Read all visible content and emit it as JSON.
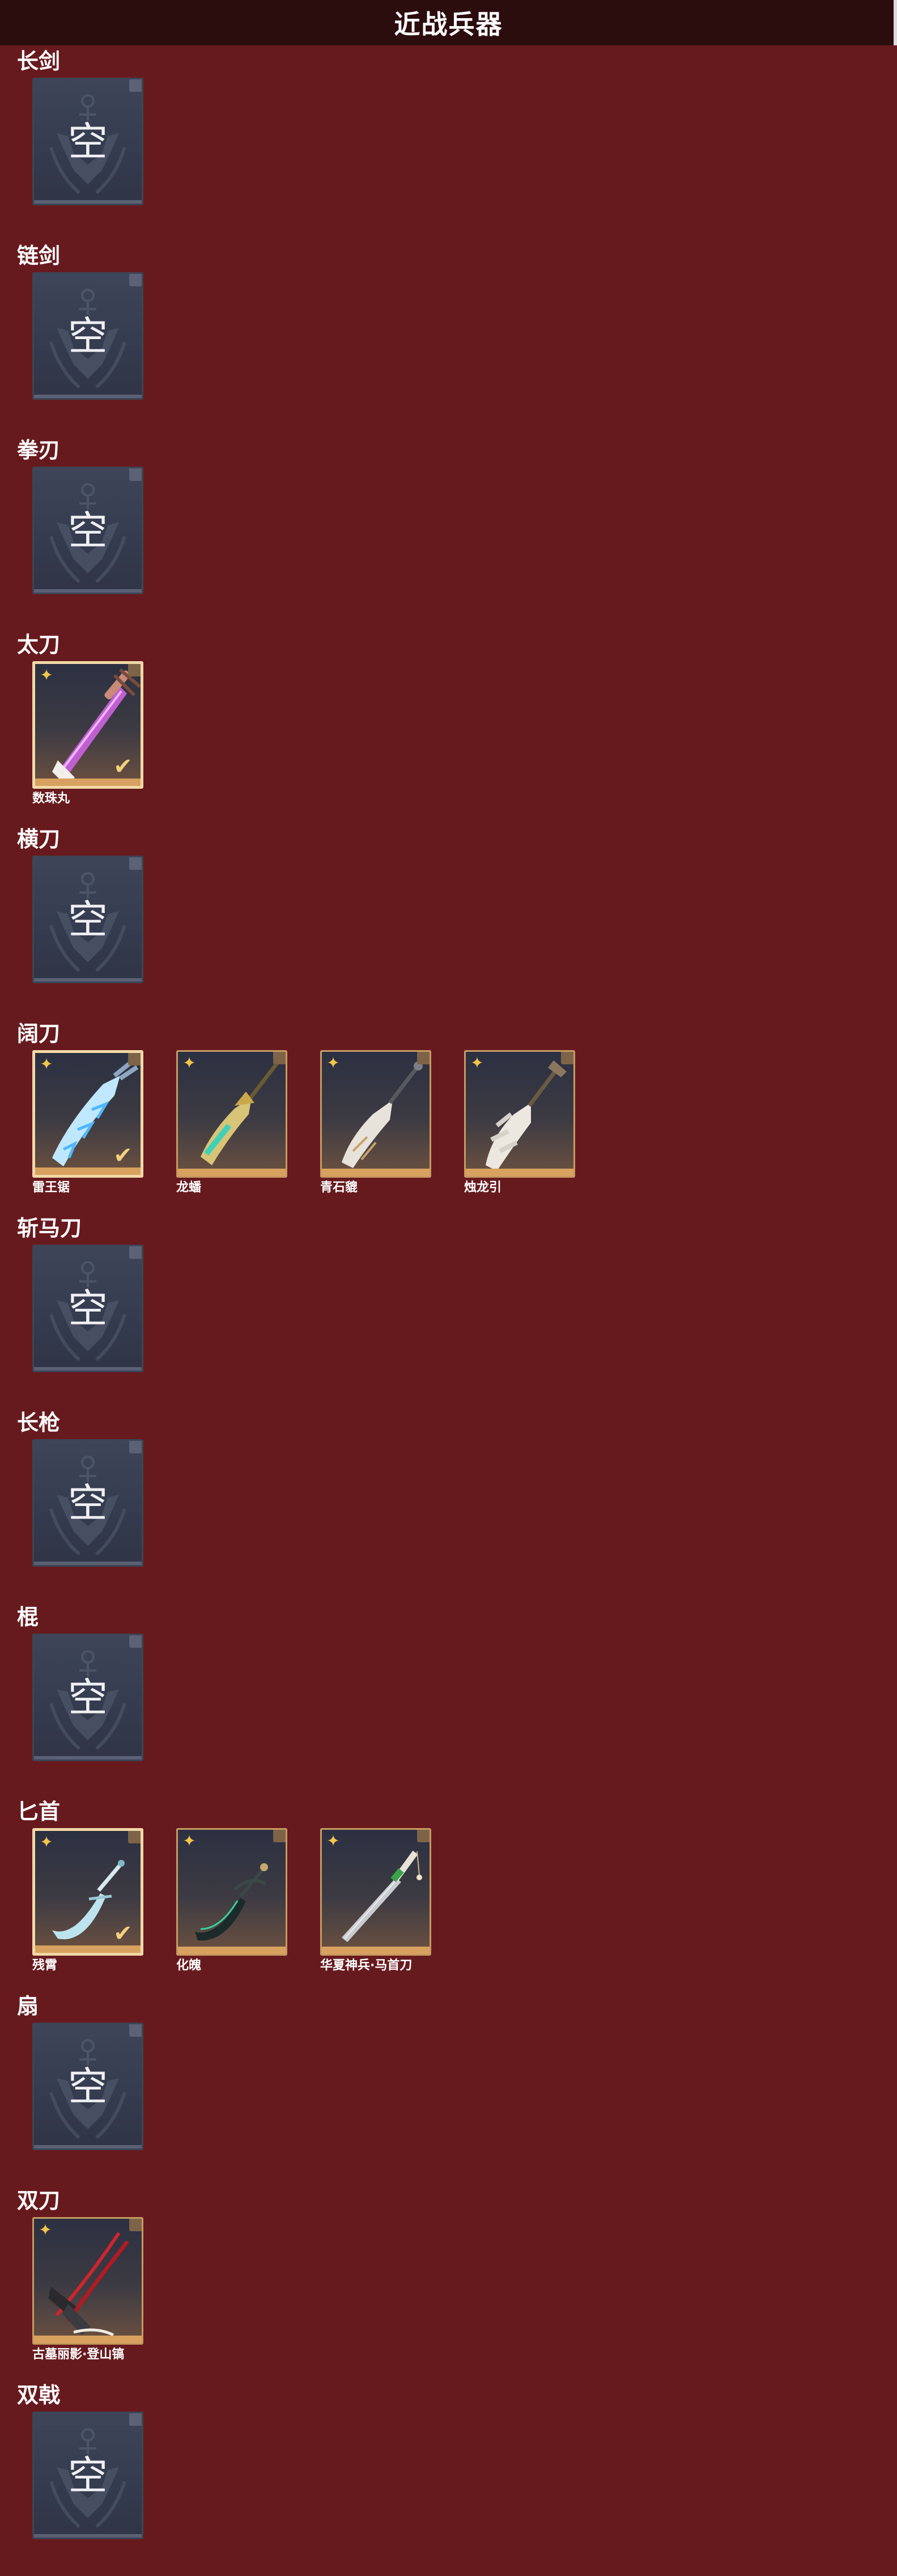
{
  "header": {
    "title": "近战兵器"
  },
  "empty_label": "空",
  "colors": {
    "background": "#671a1e",
    "header": "#2c0d0e",
    "card_empty": "#3e4559",
    "card_owned_border": "#c69a5f",
    "equipped_border": "#f1d8a6",
    "rarity_gold": "#f0c54b"
  },
  "categories": [
    {
      "label": "长剑",
      "items": []
    },
    {
      "label": "链剑",
      "items": []
    },
    {
      "label": "拳刃",
      "items": []
    },
    {
      "label": "太刀",
      "items": [
        {
          "name": "数珠丸",
          "equipped": true,
          "art": "purple-sword"
        }
      ]
    },
    {
      "label": "横刀",
      "items": []
    },
    {
      "label": "阔刀",
      "items": [
        {
          "name": "雷王锯",
          "equipped": true,
          "art": "ice-blade"
        },
        {
          "name": "龙蟠",
          "equipped": false,
          "art": "jade-glaive"
        },
        {
          "name": "青石貔",
          "equipped": false,
          "art": "stone-glaive"
        },
        {
          "name": "烛龙引",
          "equipped": false,
          "art": "bone-glaive"
        }
      ]
    },
    {
      "label": "斩马刀",
      "items": []
    },
    {
      "label": "长枪",
      "items": []
    },
    {
      "label": "棍",
      "items": []
    },
    {
      "label": "匕首",
      "items": [
        {
          "name": "残霄",
          "equipped": true,
          "art": "curved-dagger"
        },
        {
          "name": "化魄",
          "equipped": false,
          "art": "dark-dagger"
        },
        {
          "name": "华夏神兵·马首刀",
          "equipped": false,
          "art": "horse-knife"
        }
      ]
    },
    {
      "label": "扇",
      "items": []
    },
    {
      "label": "双刀",
      "items": [
        {
          "name": "古墓丽影·登山镐",
          "equipped": false,
          "art": "red-axes"
        }
      ]
    },
    {
      "label": "双戟",
      "items": []
    }
  ]
}
